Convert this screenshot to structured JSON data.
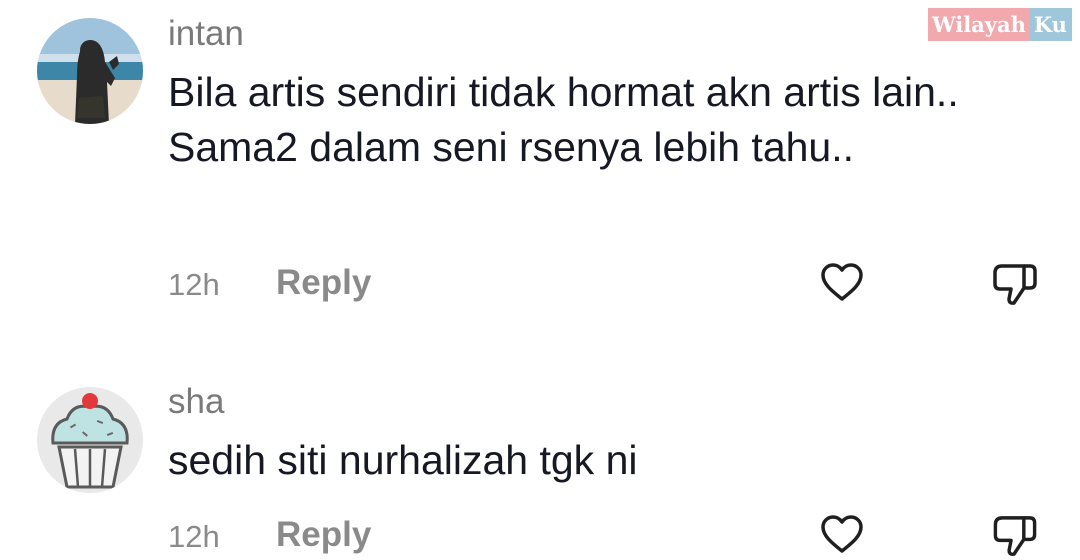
{
  "watermark": {
    "part1": "Wilayah",
    "part2": "Ku"
  },
  "comments": [
    {
      "username": "intan",
      "text": "Bila artis sendiri tidak hormat akn artis lain.. Sama2 dalam seni rsenya lebih tahu..",
      "time": "12h",
      "reply_label": "Reply"
    },
    {
      "username": "sha",
      "text": "sedih siti nurhalizah tgk ni",
      "time": "12h",
      "reply_label": "Reply"
    }
  ],
  "icons": {
    "like": "heart-icon",
    "dislike": "thumbs-down-icon"
  }
}
